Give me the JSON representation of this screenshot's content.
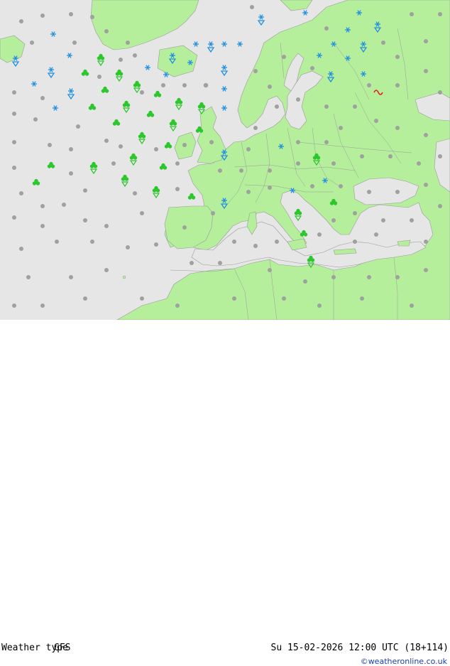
{
  "footer": {
    "type_label": "Weather type",
    "model_label": "GFS",
    "valid_time": "Su 15-02-2026 12:00 UTC (18+114)",
    "credit": "©weatheronline.co.uk"
  },
  "colors": {
    "sea": "#e6e6e6",
    "land": "#b5ef9c",
    "border": "#9a9a9a",
    "snow": "#1e8fe0",
    "rain": "#2cc72c",
    "cloud": "#a0a0a0",
    "freezing": "#e02020"
  },
  "legend_icons": [
    "snow-icon",
    "rain-shower-icon",
    "cloud-dot-icon",
    "freezing-rain-icon"
  ]
}
